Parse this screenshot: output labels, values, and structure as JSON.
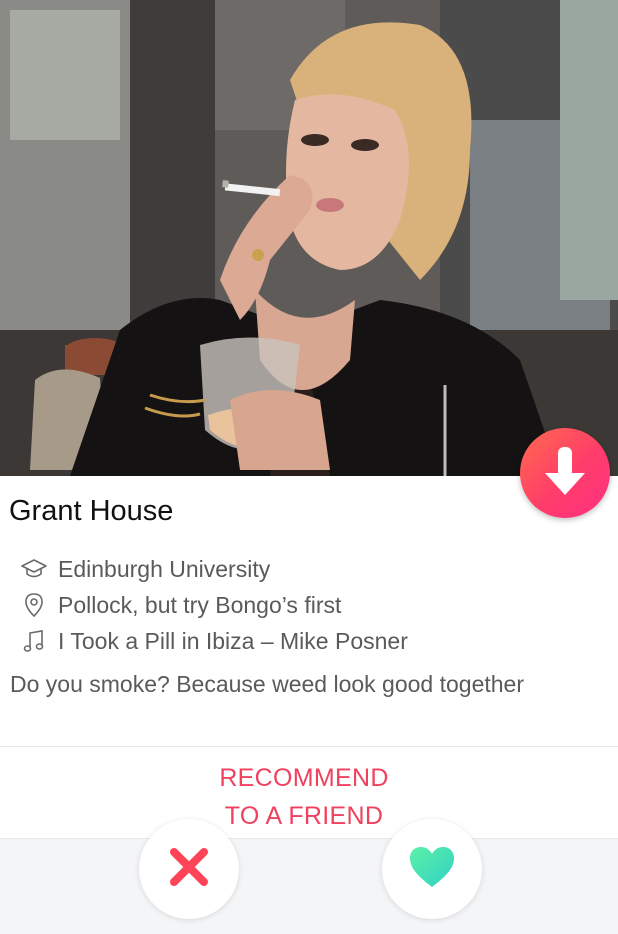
{
  "profile": {
    "name": "Grant House",
    "school": "Edinburgh University",
    "location": "Pollock, but try Bongo’s first",
    "anthem": "I Took a Pill in Ibiza – Mike Posner",
    "bio": "Do you smoke? Because weed look good together"
  },
  "actions": {
    "recommend_line1": "RECOMMEND",
    "recommend_line2": "TO A FRIEND"
  },
  "icons": {
    "school": "graduation-cap-icon",
    "location": "location-pin-icon",
    "anthem": "music-note-icon",
    "pass_down": "arrow-down-icon",
    "nope": "x-icon",
    "like": "heart-icon"
  },
  "colors": {
    "accent": "#f0415f",
    "gradient_start": "#ff6a4e",
    "gradient_end": "#ff2f82",
    "nope": "#ff4458",
    "like": "#3ee0b0"
  }
}
